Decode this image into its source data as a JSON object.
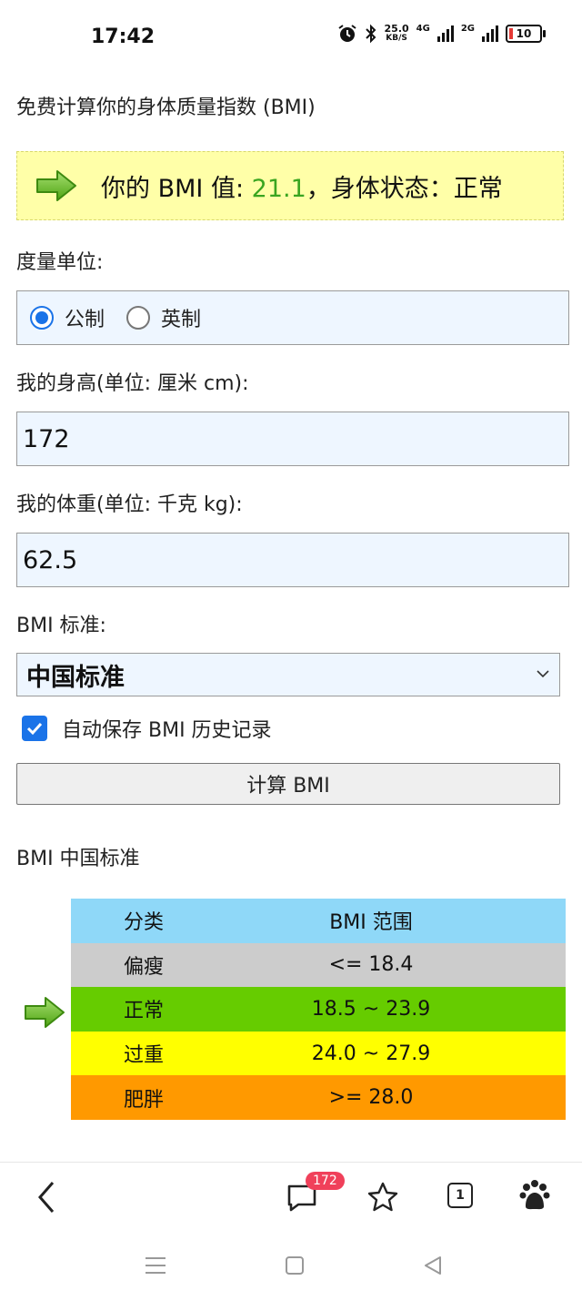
{
  "status_bar": {
    "time": "17:42",
    "net_speed_value": "25.0",
    "net_speed_unit": "KB/S",
    "network_1": "4G",
    "network_2": "2G",
    "battery": "10"
  },
  "page": {
    "heading": "免费计算你的身体质量指数 (BMI)"
  },
  "result": {
    "prefix": "你的 BMI 值: ",
    "bmi_value": "21.1",
    "suffix": "，身体状态：正常"
  },
  "units": {
    "label": "度量单位:",
    "options": [
      {
        "label": "公制",
        "checked": true
      },
      {
        "label": "英制",
        "checked": false
      }
    ]
  },
  "height": {
    "label": "我的身高(单位: 厘米 cm):",
    "value": "172"
  },
  "weight": {
    "label": "我的体重(单位: 千克 kg):",
    "value": "62.5"
  },
  "standard": {
    "label": "BMI 标准:",
    "selected": "中国标准"
  },
  "autosave": {
    "label": "自动保存 BMI 历史记录",
    "checked": true
  },
  "calculate_button": "计算 BMI",
  "table": {
    "title": "BMI 中国标准",
    "headers": [
      "分类",
      "BMI 范围"
    ],
    "rows": [
      {
        "category": "偏瘦",
        "range": "<= 18.4",
        "color": "#cccccc"
      },
      {
        "category": "正常",
        "range": "18.5 ~ 23.9",
        "color": "#66cc00"
      },
      {
        "category": "过重",
        "range": "24.0 ~ 27.9",
        "color": "#ffff00"
      },
      {
        "category": "肥胖",
        "range": ">= 28.0",
        "color": "#ff9900"
      }
    ],
    "header_color": "#8fd8f8"
  },
  "bottom_nav": {
    "messages_badge": "172",
    "tabs_count": "1"
  },
  "colors": {
    "accent": "#1a73e8",
    "result_value": "#3aa520",
    "result_bg": "#ffffa8",
    "input_bg": "#eef6ff"
  }
}
